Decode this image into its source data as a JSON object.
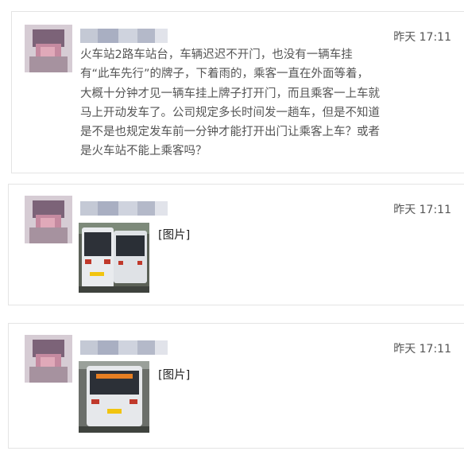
{
  "posts": [
    {
      "time": "昨天 17:11",
      "lines": [
        "火车站2路车站台，车辆迟迟不开门，也没有一辆车挂",
        "有“此车先行”的牌子，下着雨的，乘客一直在外面等着，",
        "大概十分钟才见一辆车挂上牌子打开门，而且乘客一上车就",
        "马上开动发车了。公司规定多长时间发一趟车，但是不知道",
        "是不是也规定发车前一分钟才能打开出门让乘客上车？或者",
        "是火车站不能上乘客吗？"
      ]
    },
    {
      "time": "昨天 17:11",
      "image_label": "[图片]"
    },
    {
      "time": "昨天 17:11",
      "image_label": "[图片]"
    }
  ],
  "colors": {
    "card_border": "#e4e4e4",
    "text": "#555555",
    "avatar_pixels": [
      "#b6a3b7",
      "#8f6f86",
      "#c88c9e",
      "#d3c1cd",
      "#a9989f"
    ],
    "name_pixels": [
      "#c7cbd6",
      "#d9dbe3",
      "#b8bccb",
      "#e6e7ec"
    ]
  },
  "icons": {
    "avatar": "blurred-avatar-icon",
    "photo": "bus-photo-icon"
  }
}
